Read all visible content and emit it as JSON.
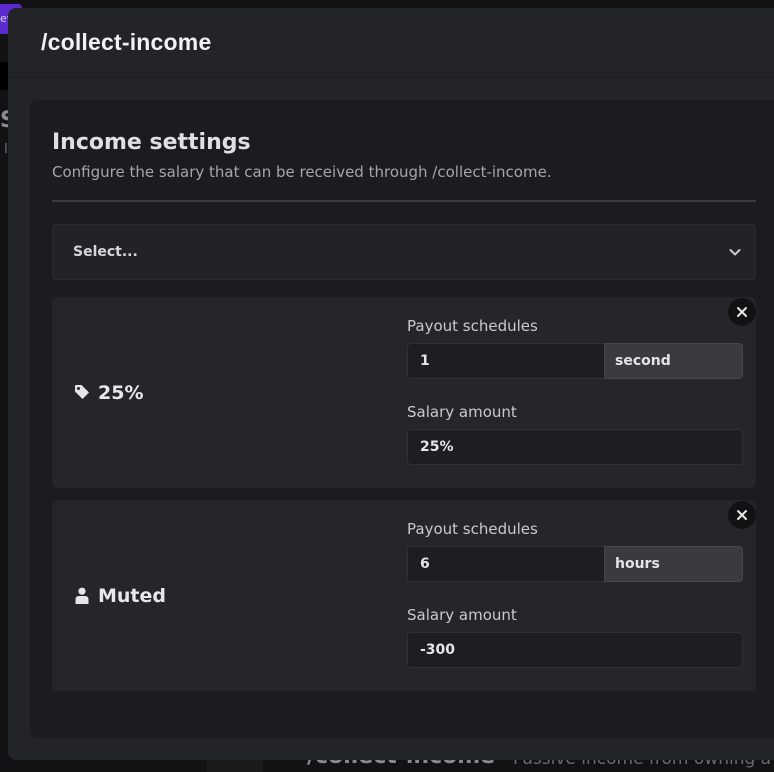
{
  "background": {
    "title": "/collect-income",
    "description": "Passive income from owning a"
  },
  "modal": {
    "title": "/collect-income"
  },
  "section": {
    "title": "Income settings",
    "description": "Configure the salary that can be received through /collect-income."
  },
  "select": {
    "placeholder": "Select..."
  },
  "cards": [
    {
      "name": "25%",
      "icon": "tag-icon",
      "payout_label": "Payout schedules",
      "payout_value": "1",
      "payout_unit": "second",
      "salary_label": "Salary amount",
      "salary_value": "25%"
    },
    {
      "name": "Muted",
      "icon": "user-icon",
      "payout_label": "Payout schedules",
      "payout_value": "6",
      "payout_unit": "hours",
      "salary_label": "Salary amount",
      "salary_value": "-300"
    }
  ],
  "colors": {
    "modal_bg": "#232428",
    "panel_bg": "#1b1c1f",
    "card_bg": "#252629",
    "accent_purple": "#5b2bd0"
  }
}
